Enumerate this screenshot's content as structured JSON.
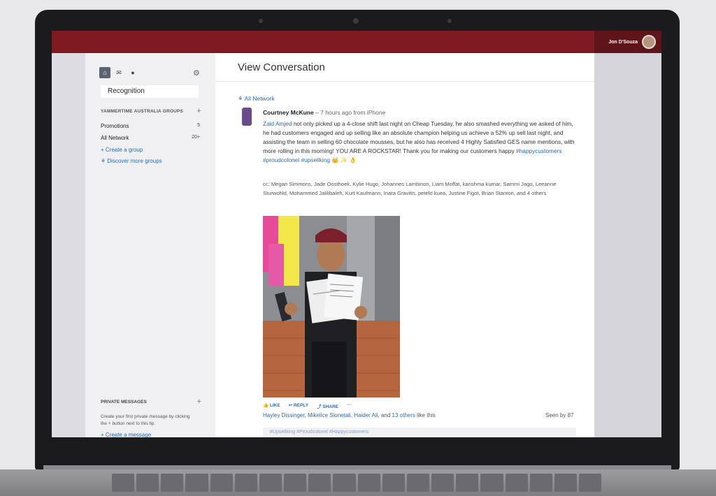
{
  "header": {
    "user_name": "Jon D'Souza"
  },
  "sidebar": {
    "search_value": "Recognition",
    "groups_header": "YAMMERTIME AUSTRALIA GROUPS",
    "groups": [
      {
        "label": "Promotions",
        "count": "5"
      },
      {
        "label": "All Network",
        "count": "20+"
      }
    ],
    "create_group": "Create a group",
    "discover_groups": "Discover more groups",
    "pm_header": "PRIVATE MESSAGES",
    "pm_tip": "Create your first private message by clicking the + button next to this tip.",
    "create_message": "Create a message"
  },
  "main": {
    "title": "View Conversation",
    "network_link": "All Network",
    "post": {
      "author": "Courtney McKune",
      "meta": " – 7 hours ago from iPhone",
      "mention": "Zaid Amjed",
      "body": " not only picked up a 4-close shift last night on Cheap Tuesday, he also smashed everything we asked of him, he had customers engaged and up selling like an absolute champion helping us achieve a 52% up sell last night, and assisting the team in selling 60 chocolate mousses, but he also has received 4 Highly Satisfied GES name mentions, with more rolling in this morning! YOU ARE A ROCKSTAR! Thank you for making our customers happy ",
      "tag1": "#happycustomers",
      "tag2": "#proudcolonel",
      "tag3": "#upsellking",
      "emojis": " 👑 ✨ 👌",
      "cc": "cc: Megan Simmons, Jade Oosthoek, Kylie Hugo, Johannes Lambinon, Liam Moffat, karishma kumar, Sammi Jago, Leeanne Sturwohld, Mohammed Jalilibaleh, Kurt Kaufmann, Inara Gravitis, petelo kuea, Justine Figot, Brian Stanton, and 4 others"
    },
    "actions": {
      "like": "LIKE",
      "reply": "REPLY",
      "share": "SHARE",
      "more": "···"
    },
    "likers": {
      "names": "Hayley Dissinger, Mikelice Sionetali, Haider Ali",
      "and": ", and ",
      "others": "13 others",
      "tail": " like this"
    },
    "seen": "Seen by 87",
    "reply_tags": "#Upsellking #Proudcolonel #Happycustomers"
  }
}
